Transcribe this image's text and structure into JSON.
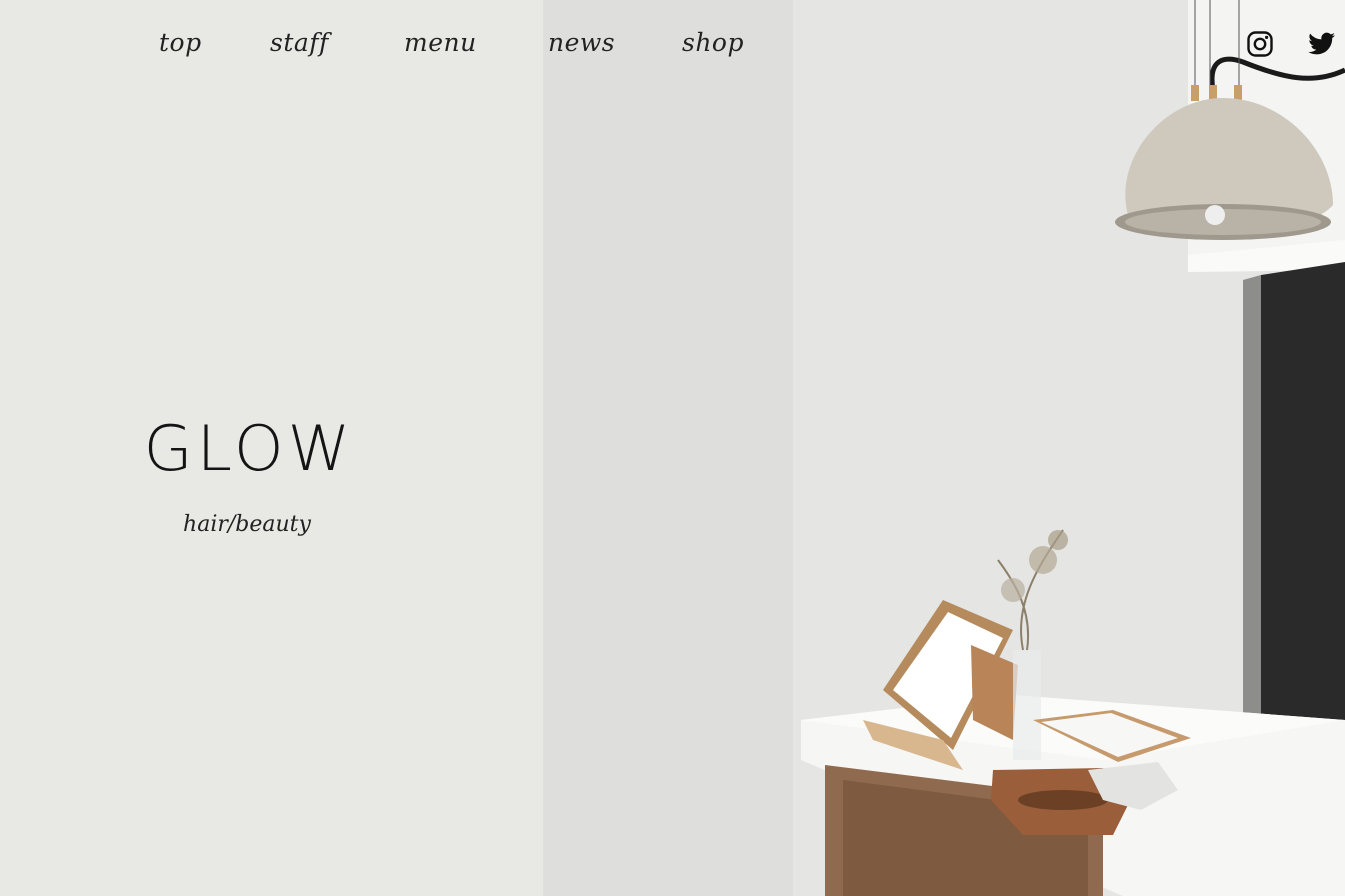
{
  "nav": {
    "items": [
      {
        "label": "top"
      },
      {
        "label": "staff"
      },
      {
        "label": "menu"
      },
      {
        "label": "news"
      },
      {
        "label": "shop"
      }
    ]
  },
  "social": {
    "instagram_icon": "instagram-icon",
    "twitter_icon": "twitter-icon"
  },
  "hero": {
    "brand": "GLOW",
    "tagline": "hair/beauty"
  },
  "colors": {
    "background": "#e8e8e4",
    "text": "#1c1c1c"
  }
}
